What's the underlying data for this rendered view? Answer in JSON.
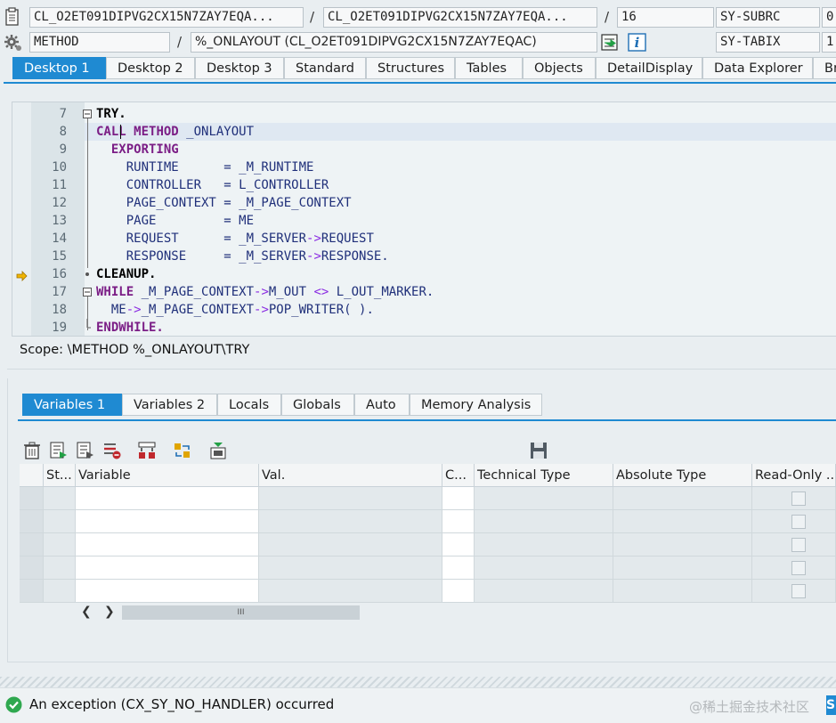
{
  "header": {
    "row1": {
      "class_field": "CL_O2ET091DIPVG2CX15N7ZAY7EQA...",
      "include_field": "CL_O2ET091DIPVG2CX15N7ZAY7EQA...",
      "line_field": "16",
      "sysvar_name": "SY-SUBRC",
      "sysvar_value": "0"
    },
    "row2": {
      "type_field": "METHOD",
      "method_field": "%_ONLAYOUT (CL_O2ET091DIPVG2CX15N7ZAY7EQAC)",
      "sysvar_name": "SY-TABIX",
      "sysvar_value": "1"
    },
    "separator": "/"
  },
  "desktop_tabs": [
    {
      "label": "Desktop 1",
      "active": true
    },
    {
      "label": "Desktop 2"
    },
    {
      "label": "Desktop 3"
    },
    {
      "label": "Standard"
    },
    {
      "label": "Structures"
    },
    {
      "label": "Tables"
    },
    {
      "label": "Objects"
    },
    {
      "label": "DetailDisplay"
    },
    {
      "label": "Data Explorer"
    },
    {
      "label": "Br"
    }
  ],
  "code": {
    "lines": [
      {
        "num": "7",
        "fold": "minus",
        "segments": [
          {
            "t": "TRY.",
            "c": "kw-b"
          }
        ]
      },
      {
        "num": "8",
        "segments": [
          {
            "t": "CALL",
            "c": "kw-p"
          },
          {
            "t": " ",
            "c": ""
          },
          {
            "t": "METHOD",
            "c": "kw-p"
          },
          {
            "t": " _ONLAYOUT",
            "c": "id-b"
          }
        ]
      },
      {
        "num": "9",
        "segments": [
          {
            "t": "  ",
            "c": ""
          },
          {
            "t": "EXPORTING",
            "c": "kw-p"
          }
        ]
      },
      {
        "num": "10",
        "segments": [
          {
            "t": "    RUNTIME      = _M_RUNTIME",
            "c": "id-b"
          }
        ]
      },
      {
        "num": "11",
        "segments": [
          {
            "t": "    CONTROLLER   = L_CONTROLLER",
            "c": "id-b"
          }
        ]
      },
      {
        "num": "12",
        "segments": [
          {
            "t": "    PAGE_CONTEXT = _M_PAGE_CONTEXT",
            "c": "id-b"
          }
        ]
      },
      {
        "num": "13",
        "segments": [
          {
            "t": "    PAGE         = ME",
            "c": "id-b"
          }
        ]
      },
      {
        "num": "14",
        "segments": [
          {
            "t": "    REQUEST      = _M_SERVER",
            "c": "id-b"
          },
          {
            "t": "->",
            "c": "op"
          },
          {
            "t": "REQUEST",
            "c": "id-b"
          }
        ]
      },
      {
        "num": "15",
        "segments": [
          {
            "t": "    RESPONSE     = _M_SERVER",
            "c": "id-b"
          },
          {
            "t": "->",
            "c": "op"
          },
          {
            "t": "RESPONSE.",
            "c": "id-b"
          }
        ]
      },
      {
        "num": "16",
        "fold": "dot",
        "current": true,
        "segments": [
          {
            "t": "CLEANUP.",
            "c": "kw-b"
          }
        ]
      },
      {
        "num": "17",
        "fold": "minus",
        "segments": [
          {
            "t": "WHILE",
            "c": "kw-p"
          },
          {
            "t": " _M_PAGE_CONTEXT",
            "c": "id-b"
          },
          {
            "t": "->",
            "c": "op"
          },
          {
            "t": "M_OUT ",
            "c": "id-b"
          },
          {
            "t": "<>",
            "c": "op"
          },
          {
            "t": " L_OUT_MARKER.",
            "c": "id-b"
          }
        ]
      },
      {
        "num": "18",
        "segments": [
          {
            "t": "  ME",
            "c": "id-b"
          },
          {
            "t": "->",
            "c": "op"
          },
          {
            "t": "_M_PAGE_CONTEXT",
            "c": "id-b"
          },
          {
            "t": "->",
            "c": "op"
          },
          {
            "t": "POP_WRITER( ).",
            "c": "id-b"
          }
        ]
      },
      {
        "num": "19",
        "fold": "end",
        "segments": [
          {
            "t": "ENDWHILE.",
            "c": "kw-p"
          }
        ]
      }
    ]
  },
  "scope": "Scope: \\METHOD %_ONLAYOUT\\TRY",
  "variable_tabs": [
    {
      "label": "Variables 1",
      "active": true
    },
    {
      "label": "Variables 2"
    },
    {
      "label": "Locals"
    },
    {
      "label": "Globals"
    },
    {
      "label": "Auto"
    },
    {
      "label": "Memory Analysis"
    }
  ],
  "toolbar_icons": [
    "trash-icon",
    "variable-list-icon",
    "variable-edit-icon",
    "delete-row-icon",
    "merge-icon",
    "move-icon",
    "export-icon",
    "save-icon"
  ],
  "grid": {
    "columns": [
      "St...",
      "Variable",
      "Val.",
      "C...",
      "Technical Type",
      "Absolute Type",
      "Read-Only ..."
    ],
    "row_count": 5
  },
  "scroll_glyph": "III",
  "status": {
    "message": "An exception (CX_SY_NO_HANDLER) occurred",
    "watermark": "@稀土掘金技术社区"
  },
  "colors": {
    "accent": "#1f8ad2",
    "success": "#2fa84f",
    "keyword_purple": "#7b1e86",
    "identifier_blue": "#20307a"
  }
}
